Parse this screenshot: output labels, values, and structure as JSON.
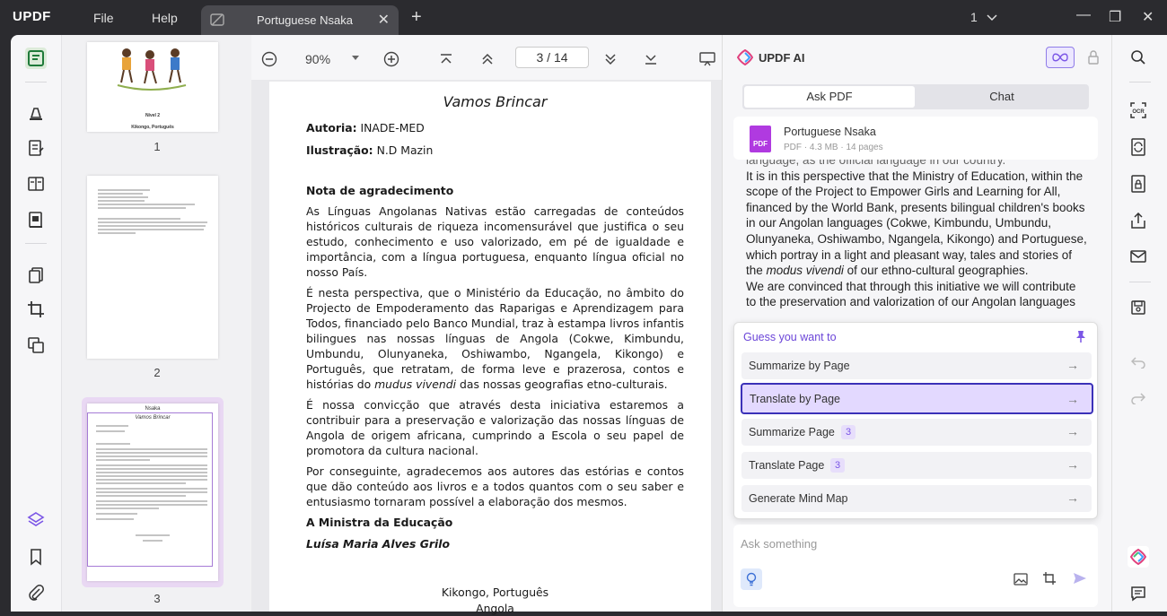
{
  "app": {
    "logo": "UPDF",
    "menu_file": "File",
    "menu_help": "Help"
  },
  "tab": {
    "title": "Portuguese Nsaka",
    "close": "✕",
    "new": "+"
  },
  "window": {
    "page_indicator": "1",
    "minimize": "—",
    "restore": "❐",
    "close": "✕"
  },
  "thumbnails": [
    {
      "label": "1",
      "title_lines": [
        "Nível 2",
        "Kikongo, Português"
      ]
    },
    {
      "label": "2"
    },
    {
      "label": "3",
      "header": "Nsaka",
      "title": "Vamos Brincar"
    }
  ],
  "viewer": {
    "zoom": "90%",
    "current_page": "3",
    "page_sep": "/",
    "total_pages": "14"
  },
  "document": {
    "title": "Vamos Brincar",
    "author_label": "Autoria:",
    "author": " INADE-MED",
    "illustration_label": "Ilustração:",
    "illustration": " N.D Mazin",
    "section_title": "Nota de agradecimento",
    "p1": "As Línguas Angolanas Nativas estão carregadas de conteúdos históricos culturais de riqueza incomensurável que justifica o seu estudo, conhecimento e uso valorizado, em pé de igualdade e importância, com a língua portuguesa, enquanto língua oficial no nosso País.",
    "p2a": "É nesta perspectiva, que o Ministério da Educação, no âmbito do Projecto de Empoderamento das Raparigas e Aprendizagem para Todos, financiado pelo Banco Mundial, traz à estampa livros infantis bilingues nas nossas línguas de Angola (Cokwe, Kimbundu, Umbundu, Olunyaneka, Oshiwambo, Ngangela, Kikongo) e Português, que retratam, de forma leve e prazerosa, contos e histórias do ",
    "p2_italic": "mudus vivendi",
    "p2b": " das nossas geografias etno-culturais.",
    "p3": "É nossa convicção que através desta iniciativa estaremos a contribuir para a preservação e valorização das nossas línguas de Angola de origem africana, cumprindo a Escola o seu papel de promotora da cultura nacional.",
    "p4": "Por conseguinte, agradecemos aos autores das estórias e contos que dão conteúdo aos livros e a todos quantos com o seu saber e entusiasmo tornaram possível a elaboração dos mesmos.",
    "signoff": "A Ministra da Educação",
    "signer": "Luísa Maria Alves Grilo",
    "place1": "Kikongo, Português",
    "place2": "Angola"
  },
  "ai_panel": {
    "title": "UPDF AI",
    "tab_ask": "Ask PDF",
    "tab_chat": "Chat",
    "file_name": "Portuguese Nsaka",
    "file_meta": "PDF · 4.3 MB · 14 pages",
    "pdf_badge": "PDF",
    "text_top": "language, as the official language in our country.",
    "text_a": "It is in this perspective that the Ministry of Education, within the scope of the Project to Empower Girls and Learning for All, financed by the World Bank, presents bilingual children's books in our Angolan languages (Cokwe, Kimbundu, Umbundu, Olunyaneka, Oshiwambo, Ngangela, Kikongo) and Portuguese, which portray in a light and pleasant way, tales and stories of the ",
    "text_italic": "modus vivendi",
    "text_b": " of our ethno-cultural geographies.",
    "text_c": "We are convinced that through this initiative we will contribute to the preservation and valorization of our Angolan languages",
    "guess_title": "Guess you want to",
    "options": [
      {
        "label": "Summarize by Page",
        "arrow": "→"
      },
      {
        "label": "Translate by Page",
        "arrow": "→"
      },
      {
        "label": "Summarize Page",
        "num": "3",
        "arrow": "→"
      },
      {
        "label": "Translate Page",
        "num": "3",
        "arrow": "→"
      },
      {
        "label": "Generate Mind Map",
        "arrow": "→"
      }
    ],
    "ask_placeholder": "Ask something"
  },
  "colors": {
    "accent": "#7b56e6",
    "selected_border": "#3b31b8",
    "pdf_icon": "#b03ae0"
  }
}
